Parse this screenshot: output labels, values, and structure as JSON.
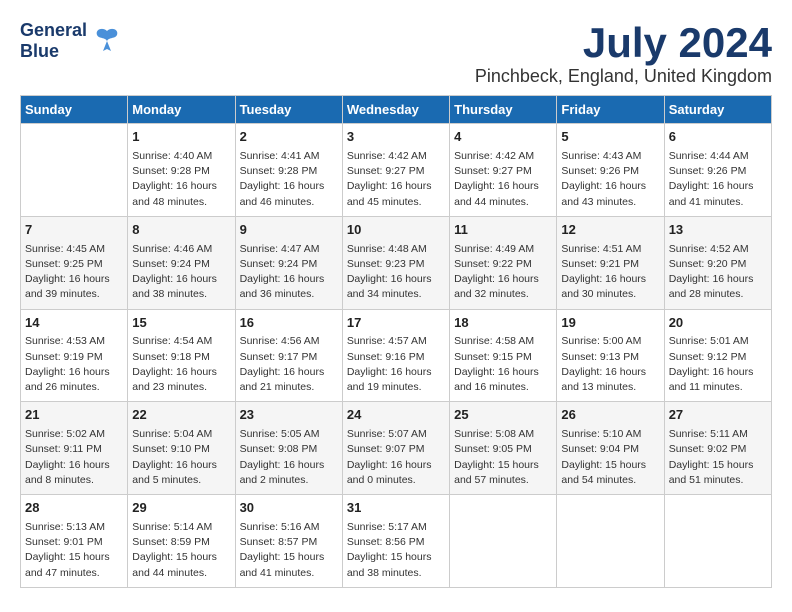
{
  "header": {
    "logo_line1": "General",
    "logo_line2": "Blue",
    "title": "July 2024",
    "subtitle": "Pinchbeck, England, United Kingdom"
  },
  "days_of_week": [
    "Sunday",
    "Monday",
    "Tuesday",
    "Wednesday",
    "Thursday",
    "Friday",
    "Saturday"
  ],
  "weeks": [
    [
      {
        "day": "",
        "content": ""
      },
      {
        "day": "1",
        "content": "Sunrise: 4:40 AM\nSunset: 9:28 PM\nDaylight: 16 hours\nand 48 minutes."
      },
      {
        "day": "2",
        "content": "Sunrise: 4:41 AM\nSunset: 9:28 PM\nDaylight: 16 hours\nand 46 minutes."
      },
      {
        "day": "3",
        "content": "Sunrise: 4:42 AM\nSunset: 9:27 PM\nDaylight: 16 hours\nand 45 minutes."
      },
      {
        "day": "4",
        "content": "Sunrise: 4:42 AM\nSunset: 9:27 PM\nDaylight: 16 hours\nand 44 minutes."
      },
      {
        "day": "5",
        "content": "Sunrise: 4:43 AM\nSunset: 9:26 PM\nDaylight: 16 hours\nand 43 minutes."
      },
      {
        "day": "6",
        "content": "Sunrise: 4:44 AM\nSunset: 9:26 PM\nDaylight: 16 hours\nand 41 minutes."
      }
    ],
    [
      {
        "day": "7",
        "content": "Sunrise: 4:45 AM\nSunset: 9:25 PM\nDaylight: 16 hours\nand 39 minutes."
      },
      {
        "day": "8",
        "content": "Sunrise: 4:46 AM\nSunset: 9:24 PM\nDaylight: 16 hours\nand 38 minutes."
      },
      {
        "day": "9",
        "content": "Sunrise: 4:47 AM\nSunset: 9:24 PM\nDaylight: 16 hours\nand 36 minutes."
      },
      {
        "day": "10",
        "content": "Sunrise: 4:48 AM\nSunset: 9:23 PM\nDaylight: 16 hours\nand 34 minutes."
      },
      {
        "day": "11",
        "content": "Sunrise: 4:49 AM\nSunset: 9:22 PM\nDaylight: 16 hours\nand 32 minutes."
      },
      {
        "day": "12",
        "content": "Sunrise: 4:51 AM\nSunset: 9:21 PM\nDaylight: 16 hours\nand 30 minutes."
      },
      {
        "day": "13",
        "content": "Sunrise: 4:52 AM\nSunset: 9:20 PM\nDaylight: 16 hours\nand 28 minutes."
      }
    ],
    [
      {
        "day": "14",
        "content": "Sunrise: 4:53 AM\nSunset: 9:19 PM\nDaylight: 16 hours\nand 26 minutes."
      },
      {
        "day": "15",
        "content": "Sunrise: 4:54 AM\nSunset: 9:18 PM\nDaylight: 16 hours\nand 23 minutes."
      },
      {
        "day": "16",
        "content": "Sunrise: 4:56 AM\nSunset: 9:17 PM\nDaylight: 16 hours\nand 21 minutes."
      },
      {
        "day": "17",
        "content": "Sunrise: 4:57 AM\nSunset: 9:16 PM\nDaylight: 16 hours\nand 19 minutes."
      },
      {
        "day": "18",
        "content": "Sunrise: 4:58 AM\nSunset: 9:15 PM\nDaylight: 16 hours\nand 16 minutes."
      },
      {
        "day": "19",
        "content": "Sunrise: 5:00 AM\nSunset: 9:13 PM\nDaylight: 16 hours\nand 13 minutes."
      },
      {
        "day": "20",
        "content": "Sunrise: 5:01 AM\nSunset: 9:12 PM\nDaylight: 16 hours\nand 11 minutes."
      }
    ],
    [
      {
        "day": "21",
        "content": "Sunrise: 5:02 AM\nSunset: 9:11 PM\nDaylight: 16 hours\nand 8 minutes."
      },
      {
        "day": "22",
        "content": "Sunrise: 5:04 AM\nSunset: 9:10 PM\nDaylight: 16 hours\nand 5 minutes."
      },
      {
        "day": "23",
        "content": "Sunrise: 5:05 AM\nSunset: 9:08 PM\nDaylight: 16 hours\nand 2 minutes."
      },
      {
        "day": "24",
        "content": "Sunrise: 5:07 AM\nSunset: 9:07 PM\nDaylight: 16 hours\nand 0 minutes."
      },
      {
        "day": "25",
        "content": "Sunrise: 5:08 AM\nSunset: 9:05 PM\nDaylight: 15 hours\nand 57 minutes."
      },
      {
        "day": "26",
        "content": "Sunrise: 5:10 AM\nSunset: 9:04 PM\nDaylight: 15 hours\nand 54 minutes."
      },
      {
        "day": "27",
        "content": "Sunrise: 5:11 AM\nSunset: 9:02 PM\nDaylight: 15 hours\nand 51 minutes."
      }
    ],
    [
      {
        "day": "28",
        "content": "Sunrise: 5:13 AM\nSunset: 9:01 PM\nDaylight: 15 hours\nand 47 minutes."
      },
      {
        "day": "29",
        "content": "Sunrise: 5:14 AM\nSunset: 8:59 PM\nDaylight: 15 hours\nand 44 minutes."
      },
      {
        "day": "30",
        "content": "Sunrise: 5:16 AM\nSunset: 8:57 PM\nDaylight: 15 hours\nand 41 minutes."
      },
      {
        "day": "31",
        "content": "Sunrise: 5:17 AM\nSunset: 8:56 PM\nDaylight: 15 hours\nand 38 minutes."
      },
      {
        "day": "",
        "content": ""
      },
      {
        "day": "",
        "content": ""
      },
      {
        "day": "",
        "content": ""
      }
    ]
  ]
}
